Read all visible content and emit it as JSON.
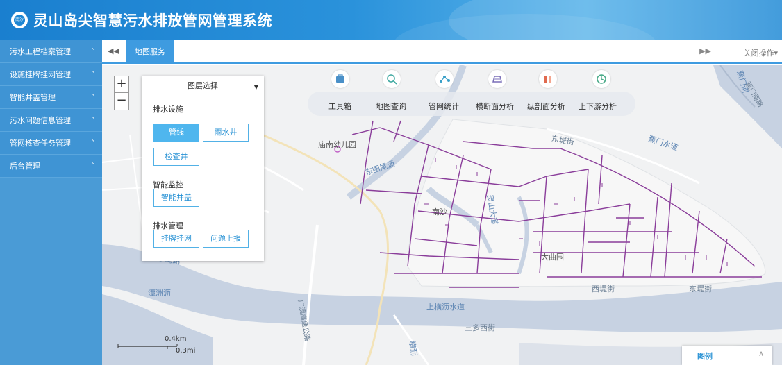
{
  "app": {
    "title": "灵山岛尖智慧污水排放管网管理系统",
    "logo_text": "南沙"
  },
  "sidebar": {
    "items": [
      {
        "label": "污水工程档案管理"
      },
      {
        "label": "设施挂牌挂网管理"
      },
      {
        "label": "智能井盖管理"
      },
      {
        "label": "污水问题信息管理"
      },
      {
        "label": "管网核查任务管理"
      },
      {
        "label": "后台管理"
      }
    ],
    "chevron": "˅"
  },
  "tabs": {
    "active": "地图服务",
    "close_ops": "关闭操作▾",
    "prev": "◀◀",
    "next": "▶▶"
  },
  "map": {
    "zoom_in": "+",
    "zoom_out": "−",
    "layer_panel": {
      "title": "图层选择",
      "caret": "▼",
      "sections": [
        {
          "title": "排水设施",
          "buttons": [
            "管线",
            "雨水井",
            "检查井"
          ]
        },
        {
          "title": "智能监控",
          "buttons": [
            "智能井盖"
          ]
        },
        {
          "title": "排水管理",
          "buttons": [
            "挂牌挂网",
            "问题上报"
          ]
        }
      ]
    },
    "tools": [
      {
        "label": "工具箱",
        "icon": "toolbox-icon",
        "color": "#4a90c8"
      },
      {
        "label": "地图查询",
        "icon": "map-search-icon",
        "color": "#3ea8a0"
      },
      {
        "label": "管网统计",
        "icon": "network-stats-icon",
        "color": "#3aa0c8"
      },
      {
        "label": "横断面分析",
        "icon": "cross-section-icon",
        "color": "#7a6fb8"
      },
      {
        "label": "纵剖面分析",
        "icon": "longitudinal-section-icon",
        "color": "#e06a4f"
      },
      {
        "label": "上下游分析",
        "icon": "upstream-downstream-icon",
        "color": "#4aaa88"
      }
    ],
    "labels": {
      "kindergarten": "庙南幼儿园",
      "east_yong": "东围尾涌",
      "nansha": "南沙",
      "dongdi_st": "东堤街",
      "jiaomen_water": "蕉门水道",
      "jiaomen_river": "蕉门河",
      "nanyu_dong": "蕉门南路",
      "daqu_wei": "大曲围",
      "west_dike": "西堤街",
      "east_dike": "东堤街",
      "tanzhou": "潭洲沥",
      "shanghengli": "上横沥水道",
      "sanduoxi": "三多西街",
      "west_road": "广澳高速公路",
      "lingshan_road": "灵山大道",
      "shuiwei": "沙湾路",
      "hengli": "横沥"
    },
    "scale": {
      "km": "0.4km",
      "mi": "0.3mi"
    },
    "legend": {
      "title": "图例",
      "chevron": "∧"
    }
  }
}
